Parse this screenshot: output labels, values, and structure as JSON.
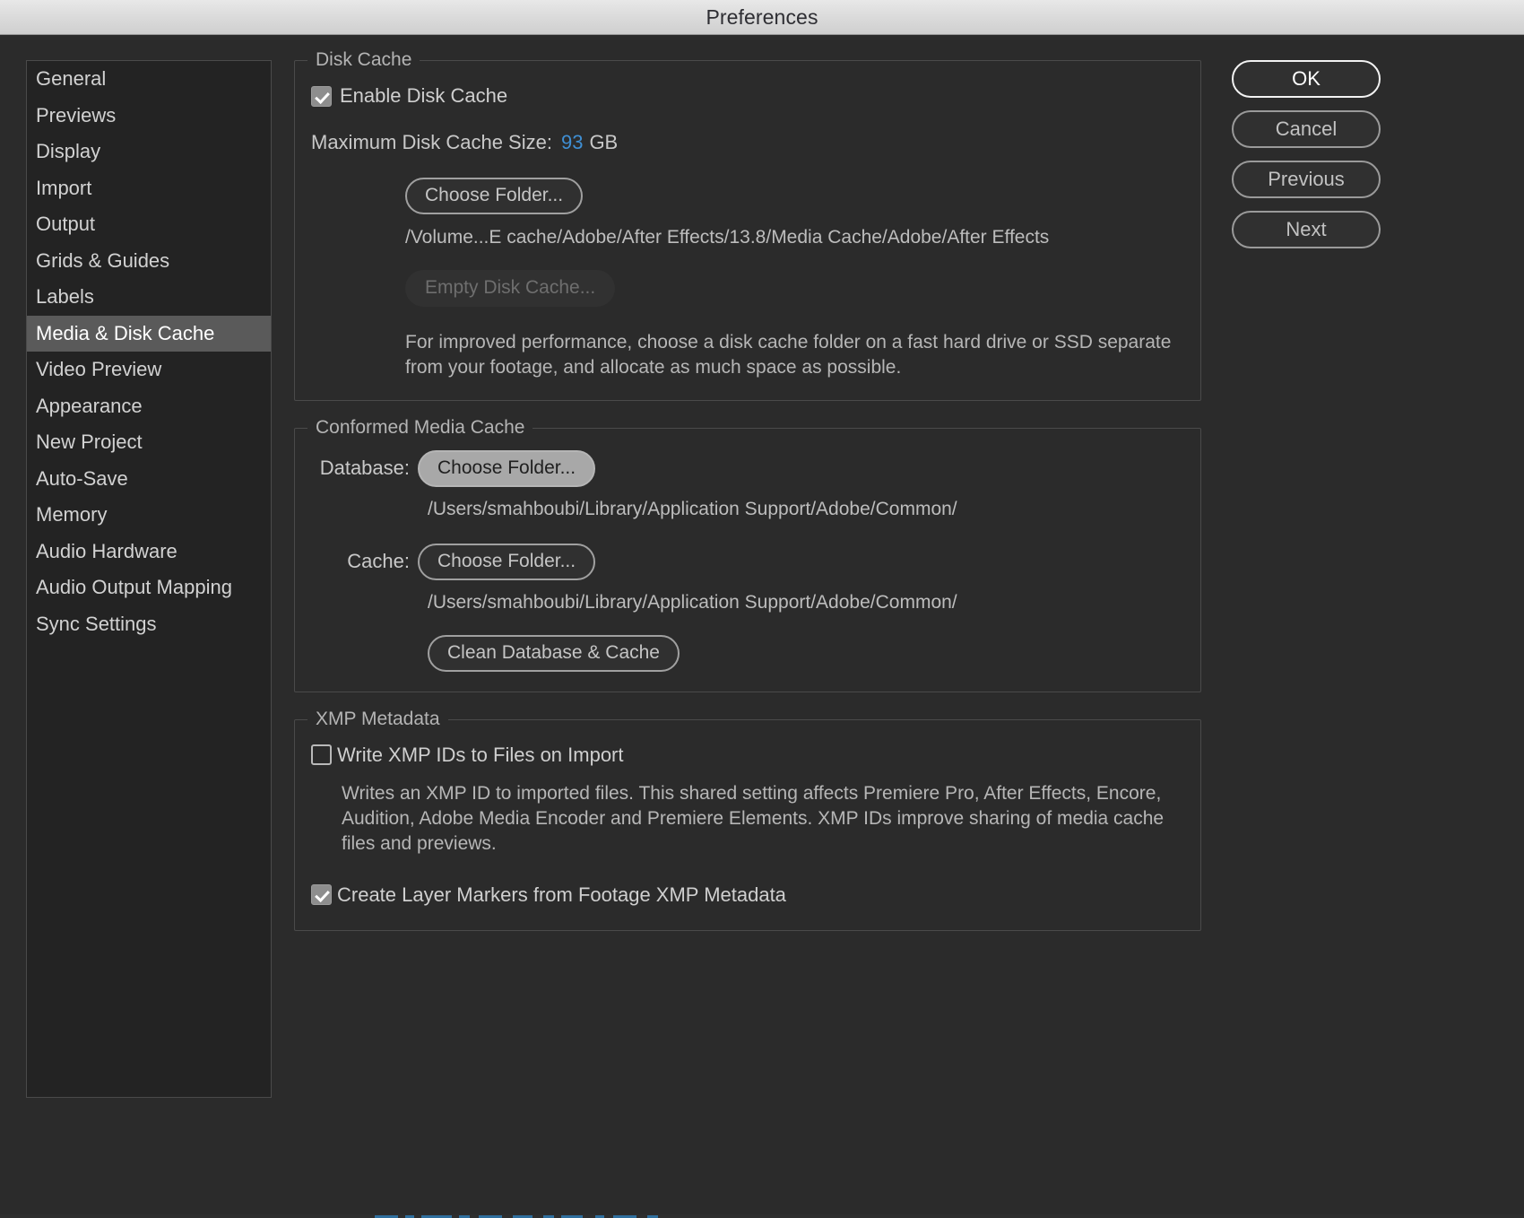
{
  "window": {
    "title": "Preferences"
  },
  "sidebar": {
    "items": [
      {
        "label": "General",
        "selected": false
      },
      {
        "label": "Previews",
        "selected": false
      },
      {
        "label": "Display",
        "selected": false
      },
      {
        "label": "Import",
        "selected": false
      },
      {
        "label": "Output",
        "selected": false
      },
      {
        "label": "Grids & Guides",
        "selected": false
      },
      {
        "label": "Labels",
        "selected": false
      },
      {
        "label": "Media & Disk Cache",
        "selected": true
      },
      {
        "label": "Video Preview",
        "selected": false
      },
      {
        "label": "Appearance",
        "selected": false
      },
      {
        "label": "New Project",
        "selected": false
      },
      {
        "label": "Auto-Save",
        "selected": false
      },
      {
        "label": "Memory",
        "selected": false
      },
      {
        "label": "Audio Hardware",
        "selected": false
      },
      {
        "label": "Audio Output Mapping",
        "selected": false
      },
      {
        "label": "Sync Settings",
        "selected": false
      }
    ]
  },
  "disk_cache": {
    "group_title": "Disk Cache",
    "enable_label": "Enable Disk Cache",
    "enable_checked": true,
    "max_size_label": "Maximum Disk Cache Size:",
    "max_size_value": "93",
    "max_size_unit": "GB",
    "choose_folder_label": "Choose Folder...",
    "path": "/Volume...E cache/Adobe/After Effects/13.8/Media Cache/Adobe/After Effects",
    "empty_cache_label": "Empty Disk Cache...",
    "empty_cache_disabled": true,
    "help_text": "For improved performance, choose a disk cache folder on a fast hard drive or SSD separate from your footage, and allocate as much space as possible."
  },
  "conformed_media_cache": {
    "group_title": "Conformed Media Cache",
    "database_label": "Database:",
    "database_button": "Choose Folder...",
    "database_button_filled": true,
    "database_path": "/Users/smahboubi/Library/Application Support/Adobe/Common/",
    "cache_label": "Cache:",
    "cache_button": "Choose Folder...",
    "cache_path": "/Users/smahboubi/Library/Application Support/Adobe/Common/",
    "clean_button": "Clean Database & Cache"
  },
  "xmp_metadata": {
    "group_title": "XMP Metadata",
    "write_ids_label": "Write XMP IDs to Files on Import",
    "write_ids_checked": false,
    "write_ids_help": "Writes an XMP ID to imported files. This shared setting affects Premiere Pro, After Effects, Encore, Audition, Adobe Media Encoder and Premiere Elements. XMP IDs improve sharing of media cache files and previews.",
    "create_markers_label": "Create Layer Markers from Footage XMP Metadata",
    "create_markers_checked": true
  },
  "dialog_buttons": [
    {
      "label": "OK",
      "default": true
    },
    {
      "label": "Cancel",
      "default": false
    },
    {
      "label": "Previous",
      "default": false
    },
    {
      "label": "Next",
      "default": false
    }
  ],
  "colors": {
    "accent_blue": "#3f8fd4",
    "window_bg": "#2b2b2b",
    "sidebar_bg": "#232323",
    "selection_bg": "#5a5a5a",
    "titlebar_top": "#e8e8e8",
    "titlebar_bottom": "#cfcfcf"
  }
}
